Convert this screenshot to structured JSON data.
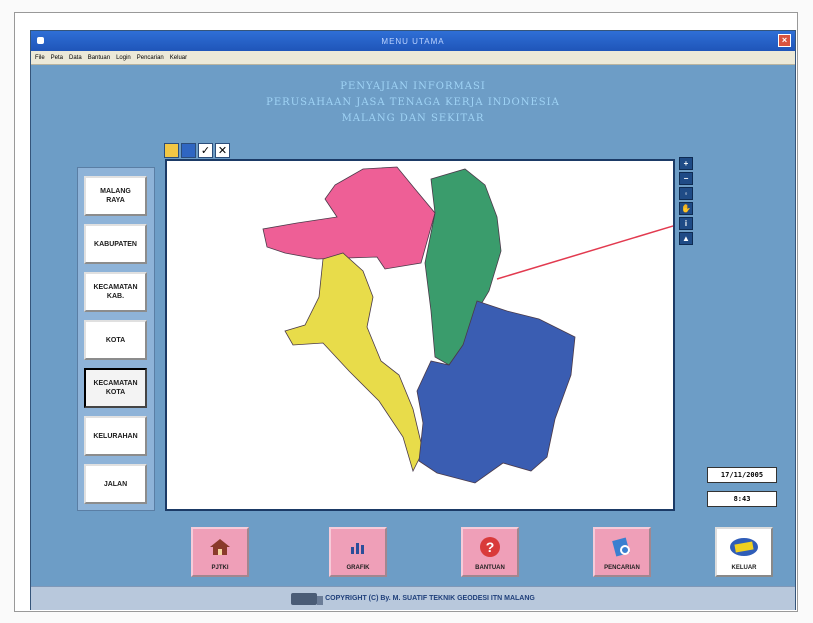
{
  "window": {
    "title": "MENU UTAMA",
    "close_glyph": "×"
  },
  "menu": [
    "File",
    "Peta",
    "Data",
    "Bantuan",
    "Login",
    "Pencarian",
    "Keluar"
  ],
  "heading": {
    "line1": "PENYAJIAN INFORMASI",
    "line2": "PERUSAHAAN JASA TENAGA KERJA INDONESIA",
    "line3": "MALANG DAN SEKITAR"
  },
  "sidebar": [
    {
      "label": "MALANG\nRAYA",
      "active": false
    },
    {
      "label": "KABUPATEN",
      "active": false
    },
    {
      "label": "KECAMATAN\nKAB.",
      "active": false
    },
    {
      "label": "KOTA",
      "active": false
    },
    {
      "label": "KECAMATAN\nKOTA",
      "active": true
    },
    {
      "label": "KELURAHAN",
      "active": false
    },
    {
      "label": "JALAN",
      "active": false
    }
  ],
  "map_toolbar": [
    {
      "icon": "open-folder-icon"
    },
    {
      "icon": "blank-icon"
    },
    {
      "icon": "check-icon",
      "glyph": "✓"
    },
    {
      "icon": "close-icon",
      "glyph": "✕"
    }
  ],
  "map_tools": [
    {
      "icon": "zoom-in-icon",
      "glyph": "+"
    },
    {
      "icon": "zoom-out-icon",
      "glyph": "−"
    },
    {
      "icon": "full-extent-icon",
      "glyph": "◦"
    },
    {
      "icon": "pan-hand-icon",
      "glyph": "✋"
    },
    {
      "icon": "info-icon",
      "glyph": "i"
    },
    {
      "icon": "pointer-icon",
      "glyph": "▲"
    }
  ],
  "map": {
    "region_colors": [
      "#ee5f96",
      "#3a9c6c",
      "#e8dc4a",
      "#8fa883",
      "#3a5db2"
    ]
  },
  "date": "17/11/2005",
  "time": "8:43",
  "bottom_buttons": [
    {
      "label": "PJTKI",
      "icon": "house-icon"
    },
    {
      "label": "GRAFIK",
      "icon": "chart-icon"
    },
    {
      "label": "BANTUAN",
      "icon": "help-icon"
    },
    {
      "label": "PENCARIAN",
      "icon": "search-icon"
    },
    {
      "label": "KELUAR",
      "icon": "exit-icon"
    }
  ],
  "copyright": "COPYRIGHT (C) By. M. SUATIF TEKNIK GEODESI ITN MALANG"
}
